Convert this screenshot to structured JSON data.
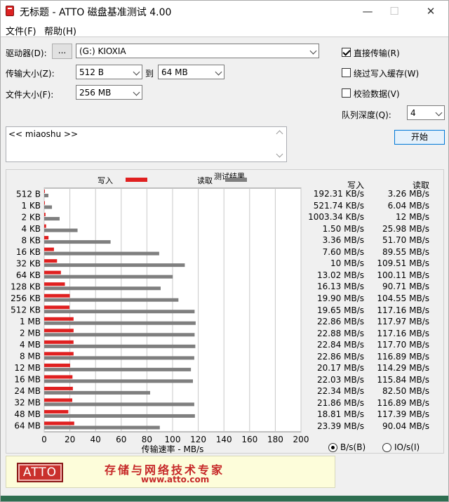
{
  "window": {
    "title": "无标题 - ATTO 磁盘基准测试 4.00",
    "minimize_glyph": "—",
    "maximize_glyph": "☐",
    "close_glyph": "✕"
  },
  "menu": {
    "file": "文件(F)",
    "help": "帮助(H)"
  },
  "form": {
    "drive_label": "驱动器(D):",
    "browse_label": "...",
    "drive_value": "(G:) KIOXIA",
    "transfer_label": "传输大小(Z):",
    "transfer_from": "512 B",
    "to_label": "到",
    "transfer_to": "64 MB",
    "filesize_label": "文件大小(F):",
    "filesize_value": "256 MB",
    "direct_io_label": "直接传输(R)",
    "bypass_cache_label": "绕过写入缓存(W)",
    "verify_label": "校验数据(V)",
    "queue_label": "队列深度(Q):",
    "queue_value": "4",
    "start_label": "开始",
    "notes_text": "<< miaoshu >>"
  },
  "results": {
    "title": "测试结果",
    "legend_write": "写入",
    "legend_read": "读取",
    "col_write": "写入",
    "col_read": "读取",
    "write_text": [
      "192.31 KB/s",
      "521.74 KB/s",
      "1003.34 KB/s",
      "1.50 MB/s",
      "3.36 MB/s",
      "7.60 MB/s",
      "10 MB/s",
      "13.02 MB/s",
      "16.13 MB/s",
      "19.90 MB/s",
      "19.65 MB/s",
      "22.86 MB/s",
      "22.88 MB/s",
      "22.84 MB/s",
      "22.86 MB/s",
      "20.17 MB/s",
      "22.03 MB/s",
      "22.34 MB/s",
      "21.86 MB/s",
      "18.81 MB/s",
      "23.39 MB/s"
    ],
    "read_text": [
      "3.26 MB/s",
      "6.04 MB/s",
      "12 MB/s",
      "25.98 MB/s",
      "51.70 MB/s",
      "89.55 MB/s",
      "109.51 MB/s",
      "100.11 MB/s",
      "90.71 MB/s",
      "104.55 MB/s",
      "117.16 MB/s",
      "117.97 MB/s",
      "117.16 MB/s",
      "117.70 MB/s",
      "116.89 MB/s",
      "114.29 MB/s",
      "115.84 MB/s",
      "82.50 MB/s",
      "116.89 MB/s",
      "117.39 MB/s",
      "90.04 MB/s"
    ]
  },
  "units": {
    "bytes_label": "B/s(B)",
    "io_label": "IO/s(I)"
  },
  "banner": {
    "logo_text": "ATTO",
    "slogan": "存储与网络技术专家",
    "url": "www.atto.com"
  },
  "chart_data": {
    "type": "bar",
    "orientation": "horizontal",
    "categories": [
      "512 B",
      "1 KB",
      "2 KB",
      "4 KB",
      "8 KB",
      "16 KB",
      "32 KB",
      "64 KB",
      "128 KB",
      "256 KB",
      "512 KB",
      "1 MB",
      "2 MB",
      "4 MB",
      "8 MB",
      "12 MB",
      "16 MB",
      "24 MB",
      "32 MB",
      "48 MB",
      "64 MB"
    ],
    "series": [
      {
        "name": "写入",
        "color": "#e02020",
        "values": [
          0.19,
          0.52,
          1.0,
          1.5,
          3.36,
          7.6,
          10,
          13.02,
          16.13,
          19.9,
          19.65,
          22.86,
          22.88,
          22.84,
          22.86,
          20.17,
          22.03,
          22.34,
          21.86,
          18.81,
          23.39
        ]
      },
      {
        "name": "读取",
        "color": "#7f7f7f",
        "values": [
          3.26,
          6.04,
          12,
          25.98,
          51.7,
          89.55,
          109.51,
          100.11,
          90.71,
          104.55,
          117.16,
          117.97,
          117.16,
          117.7,
          116.89,
          114.29,
          115.84,
          82.5,
          116.89,
          117.39,
          90.04
        ]
      }
    ],
    "xlabel": "传输速率 - MB/s",
    "xlim": [
      0,
      200
    ],
    "xticks": [
      0,
      20,
      40,
      60,
      80,
      100,
      120,
      140,
      160,
      180,
      200
    ],
    "grid": true,
    "legend": "top"
  }
}
